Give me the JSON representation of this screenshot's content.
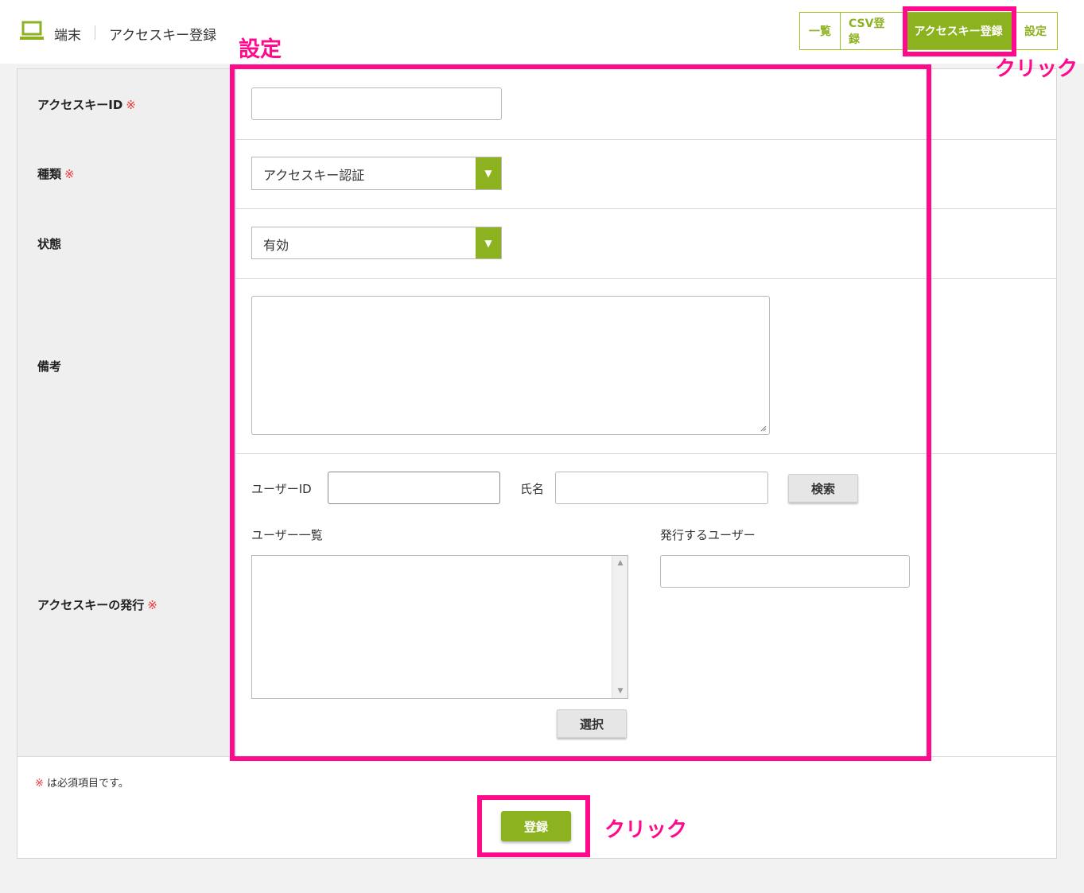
{
  "header": {
    "section": "端末",
    "page": "アクセスキー登録",
    "tabs": [
      {
        "label": "一覧"
      },
      {
        "label": "CSV登録"
      },
      {
        "label": "アクセスキー登録"
      },
      {
        "label": "設定"
      }
    ]
  },
  "form": {
    "access_key_id": {
      "label": "アクセスキーID",
      "required_mark": "※",
      "value": ""
    },
    "type": {
      "label": "種類",
      "required_mark": "※",
      "selected": "アクセスキー認証"
    },
    "status": {
      "label": "状態",
      "selected": "有効"
    },
    "remarks": {
      "label": "備考",
      "value": ""
    },
    "issue": {
      "label": "アクセスキーの発行",
      "required_mark": "※",
      "user_id_label": "ユーザーID",
      "user_id_value": "",
      "name_label": "氏名",
      "name_value": "",
      "search_button": "検索",
      "user_list_label": "ユーザー一覧",
      "issue_users_label": "発行するユーザー",
      "select_button": "選択"
    }
  },
  "footer": {
    "note_mark": "※",
    "note_text": " は必須項目です。",
    "register_button": "登録"
  },
  "annotations": {
    "settings_label": "設定",
    "click_tab": "クリック",
    "click_register": "クリック",
    "highlight_color": "#ff0a8c"
  },
  "colors": {
    "accent": "#8db220"
  }
}
